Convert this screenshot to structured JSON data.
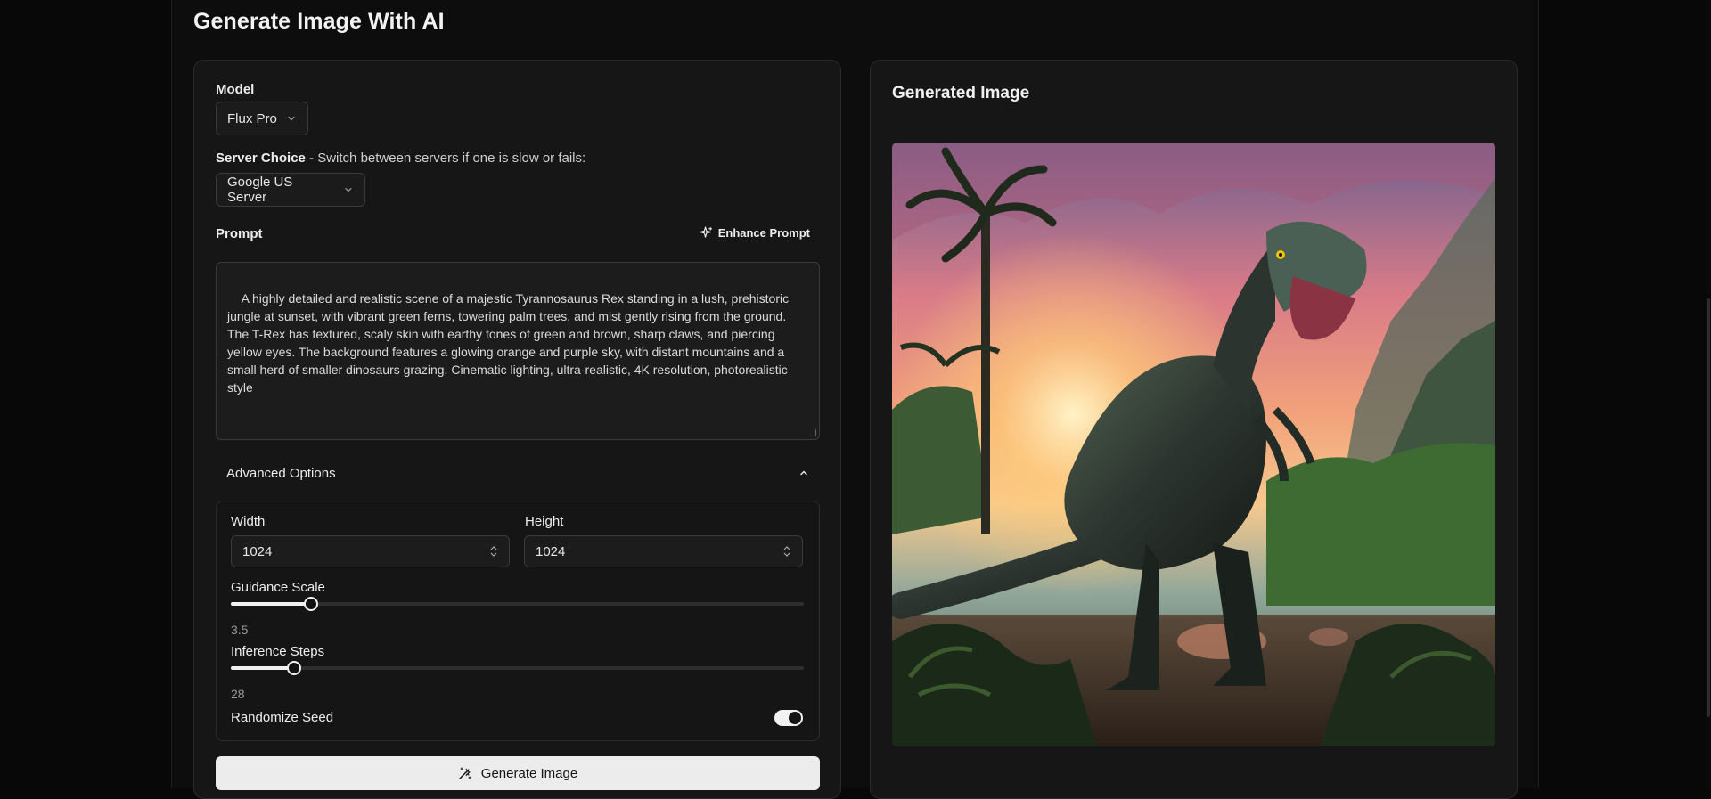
{
  "page": {
    "title": "Generate Image With AI"
  },
  "form": {
    "model_label": "Model",
    "model_value": "Flux Pro",
    "server_label": "Server Choice",
    "server_hint": " - Switch between servers if one is slow or fails:",
    "server_value": "Google US Server",
    "prompt_label": "Prompt",
    "enhance_label": "Enhance Prompt",
    "prompt_text": "A highly detailed and realistic scene of a majestic Tyrannosaurus Rex standing in a lush, prehistoric jungle at sunset, with vibrant green ferns, towering palm trees, and mist gently rising from the ground. The T-Rex has textured, scaly skin with earthy tones of green and brown, sharp claws, and piercing yellow eyes. The background features a glowing orange and purple sky, with distant mountains and a small herd of smaller dinosaurs grazing. Cinematic lighting, ultra-realistic, 4K resolution, photorealistic style",
    "advanced_label": "Advanced Options",
    "width_label": "Width",
    "width_value": "1024",
    "height_label": "Height",
    "height_value": "1024",
    "guidance_label": "Guidance Scale",
    "guidance_value": "3.5",
    "guidance_fraction": 0.14,
    "steps_label": "Inference Steps",
    "steps_value": "28",
    "steps_fraction": 0.11,
    "randomize_label": "Randomize Seed",
    "randomize_on": true,
    "generate_label": "Generate Image"
  },
  "output": {
    "title": "Generated Image",
    "image_subject": "T-Rex in prehistoric jungle at sunset"
  },
  "icons": {
    "model_chevron": "chevron-down-icon",
    "server_chevron": "chevron-down-icon",
    "enhance": "sparkles-icon",
    "advanced_toggle": "chevron-up-icon",
    "generate": "magic-wand-icon"
  },
  "colors": {
    "background": "#080808",
    "card": "#161616",
    "button": "#ececec",
    "accent_slider": "#f0f0f0"
  }
}
